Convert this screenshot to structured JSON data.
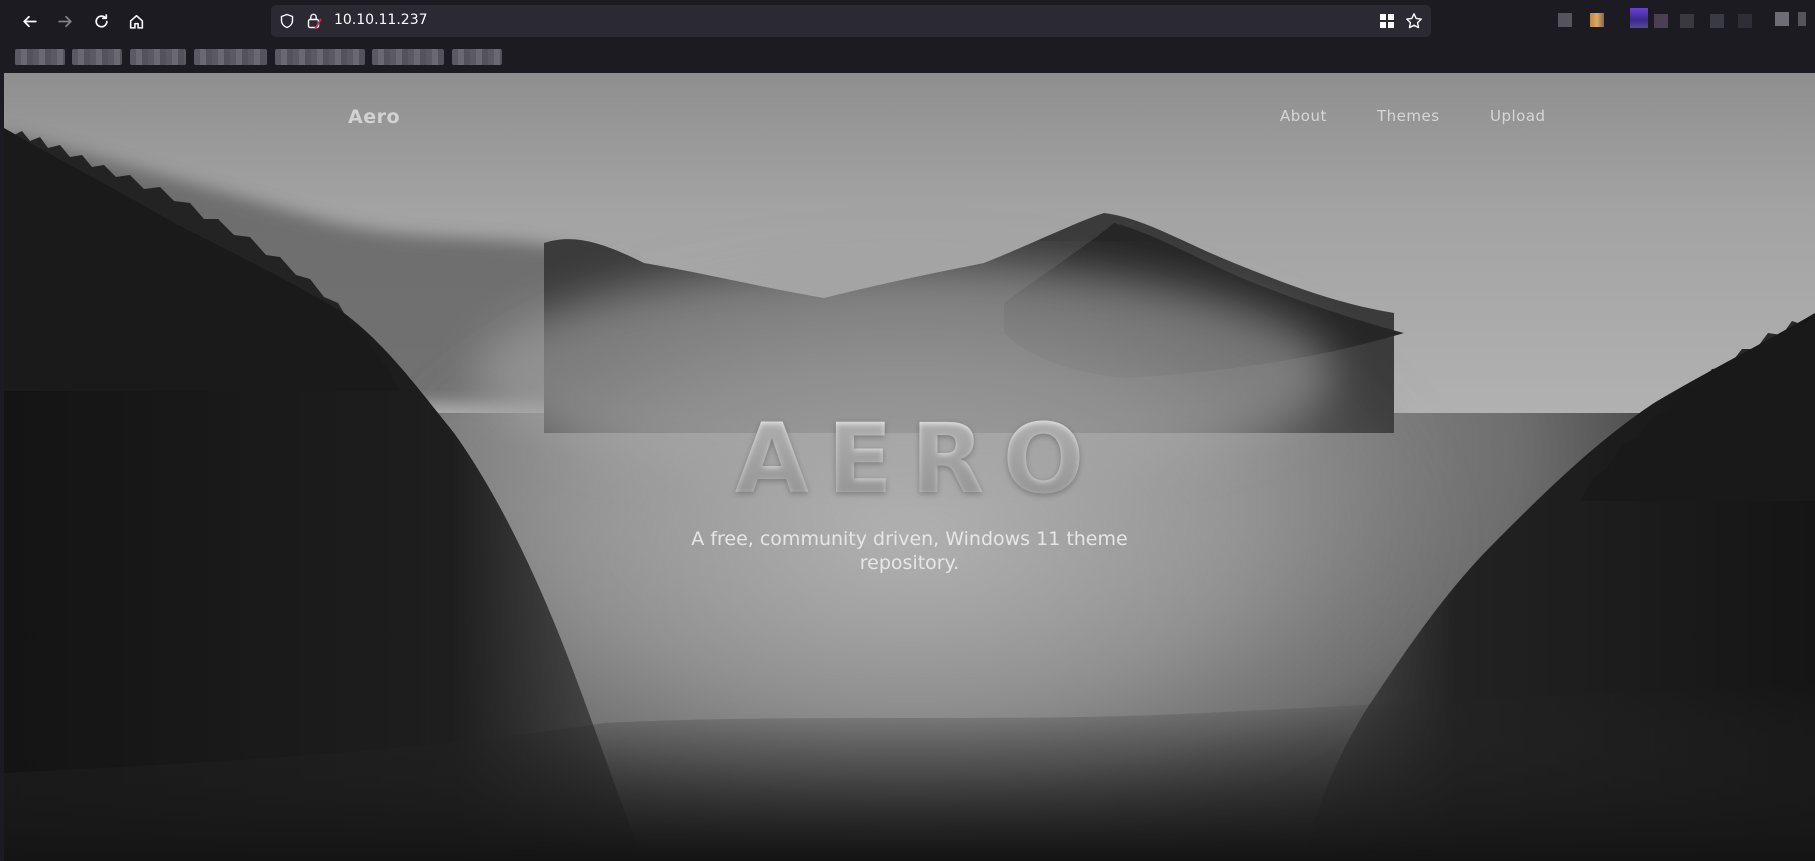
{
  "browser": {
    "url": "10.10.11.237",
    "icons": {
      "back": "arrow-left-icon",
      "forward": "arrow-right-icon",
      "reload": "reload-icon",
      "home": "home-icon",
      "tracking": "shield-icon",
      "security": "lock-warning-icon",
      "extensions": "extensions-grid-icon",
      "bookmark": "star-icon"
    },
    "accent": "#fbfbfe",
    "chrome_bg": "#1c1b22",
    "urlbar_bg": "#2b2a33"
  },
  "site": {
    "brand": "Aero",
    "nav": [
      "About",
      "Themes",
      "Upload"
    ],
    "hero": {
      "title": "AERO",
      "subtitle_line1": "A free, community driven, Windows 11 theme",
      "subtitle_line2": "repository."
    }
  }
}
